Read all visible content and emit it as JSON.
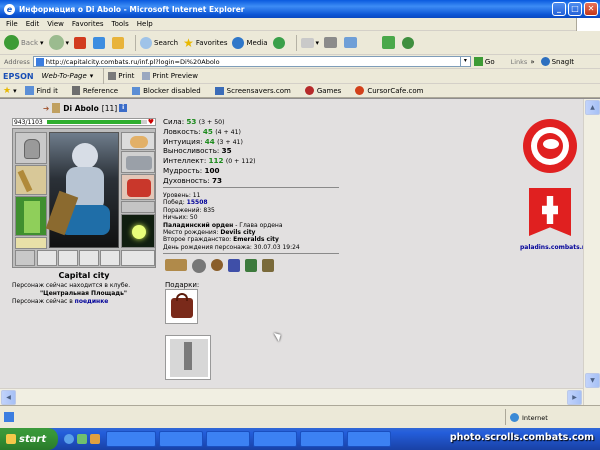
{
  "window": {
    "title": "Информация о Di Abolo - Microsoft Internet Explorer"
  },
  "menu": [
    "File",
    "Edit",
    "View",
    "Favorites",
    "Tools",
    "Help"
  ],
  "toolbar": {
    "back": "Back",
    "search": "Search",
    "favorites": "Favorites",
    "media": "Media"
  },
  "address": {
    "label": "Address",
    "url": "http://capitalcity.combats.ru/inf.pl?login=Di%20Abolo",
    "go": "Go",
    "links": "Links",
    "snagit": "SnagIt"
  },
  "epson_bar": {
    "brand": "EPSON",
    "web_to_page": "Web-To-Page",
    "print": "Print",
    "print_preview": "Print Preview"
  },
  "links_bar": {
    "find": "Find it",
    "reference": "Reference",
    "blocker": "Blocker disabled",
    "screensavers": "Screensavers.com",
    "games": "Games",
    "cursorcafe": "CursorCafe.com"
  },
  "character": {
    "name": "Di Abolo",
    "level": "[11]",
    "hp": "943/1103",
    "city": "Capital city",
    "location_line1": "Персонаж сейчас находится в клубе.",
    "location_line2": "\"Центральная Площадь\"",
    "battle_prefix": "Персонаж сейчас в",
    "battle_link": "поединке",
    "stats": [
      {
        "label": "Сила:",
        "value": "53",
        "extra": "(3 + 50)",
        "green": true
      },
      {
        "label": "Ловкость:",
        "value": "45",
        "extra": "(4 + 41)",
        "green": true
      },
      {
        "label": "Интуиция:",
        "value": "44",
        "extra": "(3 + 41)",
        "green": true
      },
      {
        "label": "Выносливость:",
        "value": "35",
        "extra": "",
        "green": false
      },
      {
        "label": "Интеллект:",
        "value": "112",
        "extra": "(0 + 112)",
        "green": true
      },
      {
        "label": "Мудрость:",
        "value": "100",
        "extra": "",
        "green": false
      },
      {
        "label": "Духовность:",
        "value": "73",
        "extra": "",
        "green": false
      }
    ],
    "info": {
      "level": "Уровень: 11",
      "wins_label": "Побед:",
      "wins": "15508",
      "losses": "Поражений: 835",
      "draws": "Ничьих: 50",
      "order_bold": "Паладинский орден",
      "order_rest": " - Глава ордена",
      "birth_label": "Место рождения:",
      "birth": "Devils city",
      "citizen_label": "Второе гражданство:",
      "citizen": "Emeralds city",
      "birthday": "День рождения персонажа: 30.07.03 19:24"
    },
    "gifts_label": "Подарки:",
    "clan_site": "paladins.combats.ru"
  },
  "status": {
    "zone": "Internet"
  },
  "taskbar": {
    "start": "start",
    "watermark": "photo.scrolls.combats.com"
  },
  "colors": {
    "xp_blue": "#0a5ade",
    "hp_green": "#2fae2f",
    "order_red": "#e02020"
  }
}
